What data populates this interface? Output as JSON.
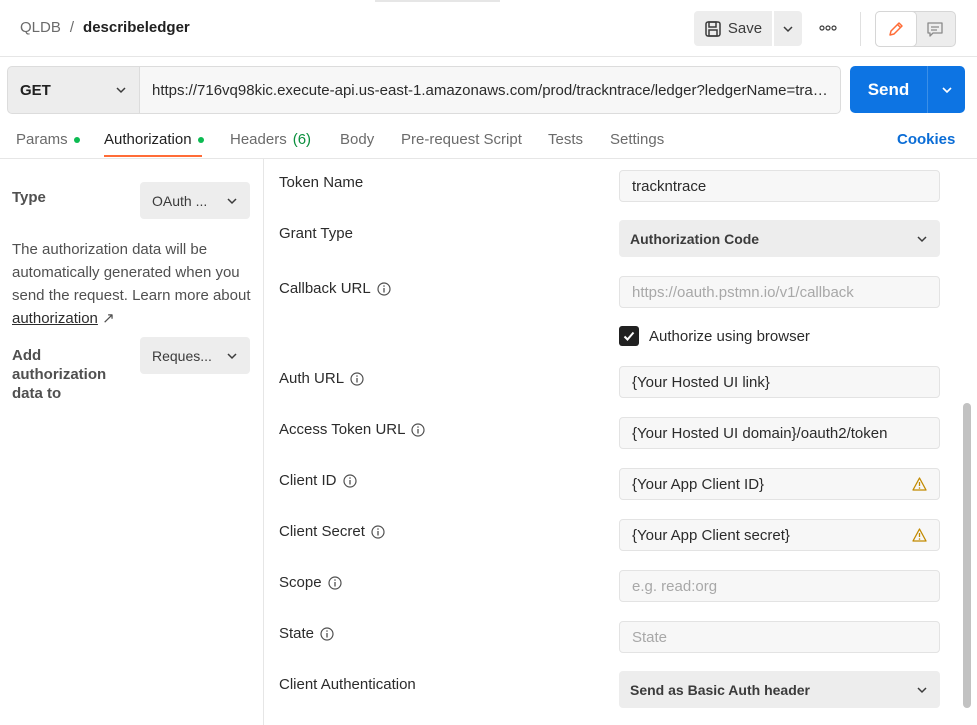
{
  "breadcrumb": {
    "parent": "QLDB",
    "separator": "/",
    "name": "describeledger"
  },
  "toolbar": {
    "save_label": "Save"
  },
  "request": {
    "method": "GET",
    "url": "https://716vq98kic.execute-api.us-east-1.amazonaws.com/prod/trackntrace/ledger?ledgerName=trac...",
    "send_label": "Send"
  },
  "tabs": {
    "params": "Params",
    "authorization": "Authorization",
    "headers": "Headers",
    "headers_count": "(6)",
    "body": "Body",
    "prerequest": "Pre-request Script",
    "tests": "Tests",
    "settings": "Settings",
    "cookies": "Cookies"
  },
  "auth_panel": {
    "type_label": "Type",
    "type_value": "OAuth ...",
    "description": "The authorization data will be automatically generated when you send the request. Learn more about",
    "learn_link": "authorization",
    "link_arrow": "↗",
    "add_to_label": "Add authorization data to",
    "add_to_value": "Reques..."
  },
  "form": {
    "token_name": {
      "label": "Token Name",
      "value": "trackntrace"
    },
    "grant_type": {
      "label": "Grant Type",
      "value": "Authorization Code"
    },
    "callback_url": {
      "label": "Callback URL",
      "placeholder": "https://oauth.pstmn.io/v1/callback"
    },
    "authorize_browser": {
      "label": "Authorize using browser",
      "checked": true
    },
    "auth_url": {
      "label": "Auth URL",
      "value": "{Your Hosted UI link}"
    },
    "access_token_url": {
      "label": "Access Token URL",
      "value": "{Your Hosted UI domain}/oauth2/token"
    },
    "client_id": {
      "label": "Client ID",
      "value": "{Your App Client ID}"
    },
    "client_secret": {
      "label": "Client Secret",
      "value": "{Your App Client secret}"
    },
    "scope": {
      "label": "Scope",
      "placeholder": "e.g. read:org"
    },
    "state": {
      "label": "State",
      "placeholder": "State"
    },
    "client_auth": {
      "label": "Client Authentication",
      "value": "Send as Basic Auth header"
    }
  },
  "colors": {
    "accent_orange": "#ff6c37",
    "send_blue": "#0d74e3",
    "status_green": "#0cbb52",
    "warning_amber": "#e0a800"
  },
  "icons": [
    "save-icon",
    "chevron-down-icon",
    "more-icon",
    "edit-icon",
    "comment-icon",
    "info-icon",
    "warning-icon",
    "check-icon",
    "external-link-icon"
  ]
}
